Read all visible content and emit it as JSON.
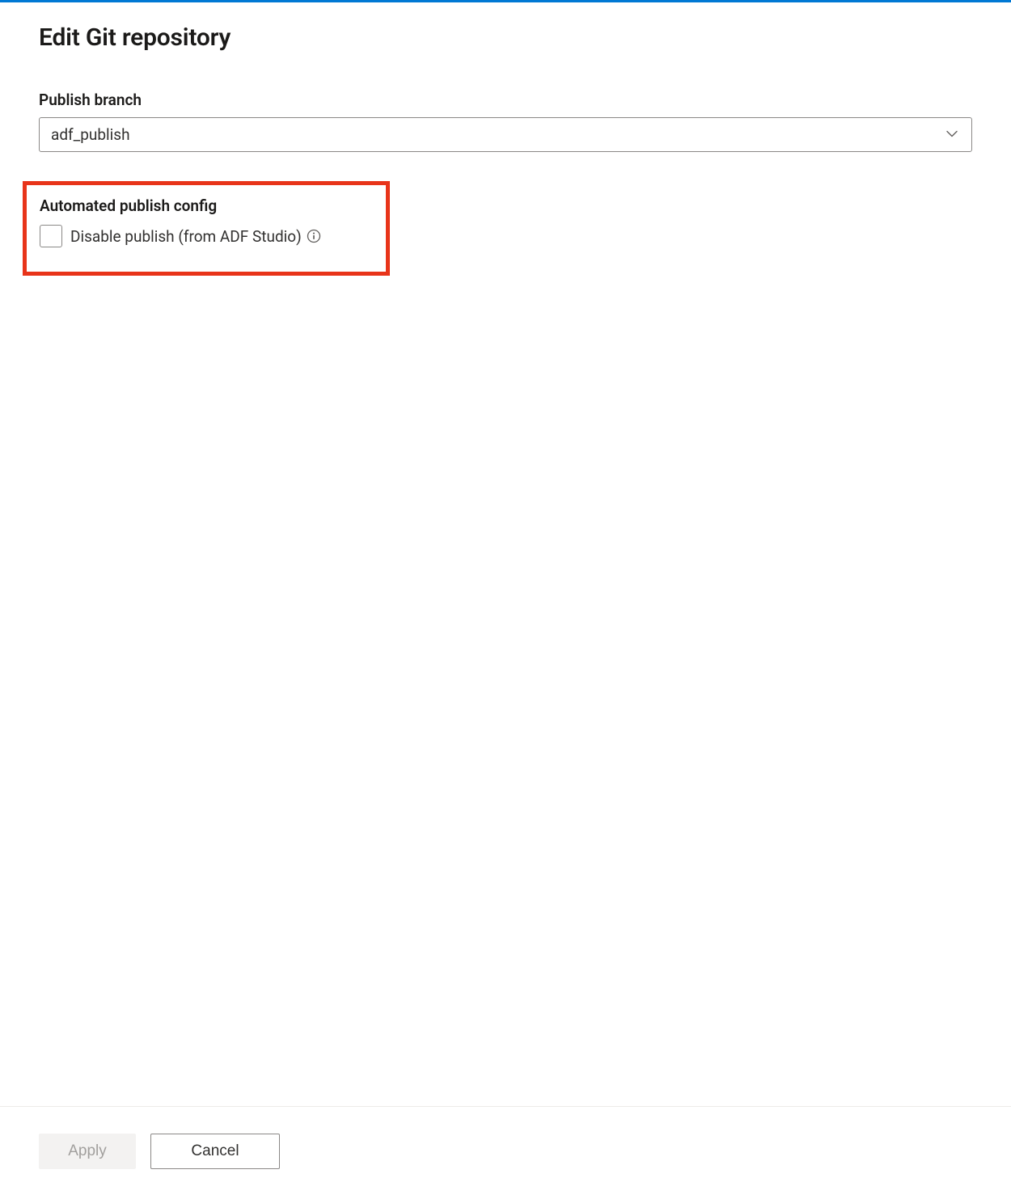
{
  "header": {
    "title": "Edit Git repository"
  },
  "publishBranch": {
    "label": "Publish branch",
    "value": "adf_publish"
  },
  "autoPublish": {
    "sectionLabel": "Automated publish config",
    "checkboxLabel": "Disable publish (from ADF Studio)",
    "checked": false
  },
  "footer": {
    "applyLabel": "Apply",
    "cancelLabel": "Cancel"
  }
}
